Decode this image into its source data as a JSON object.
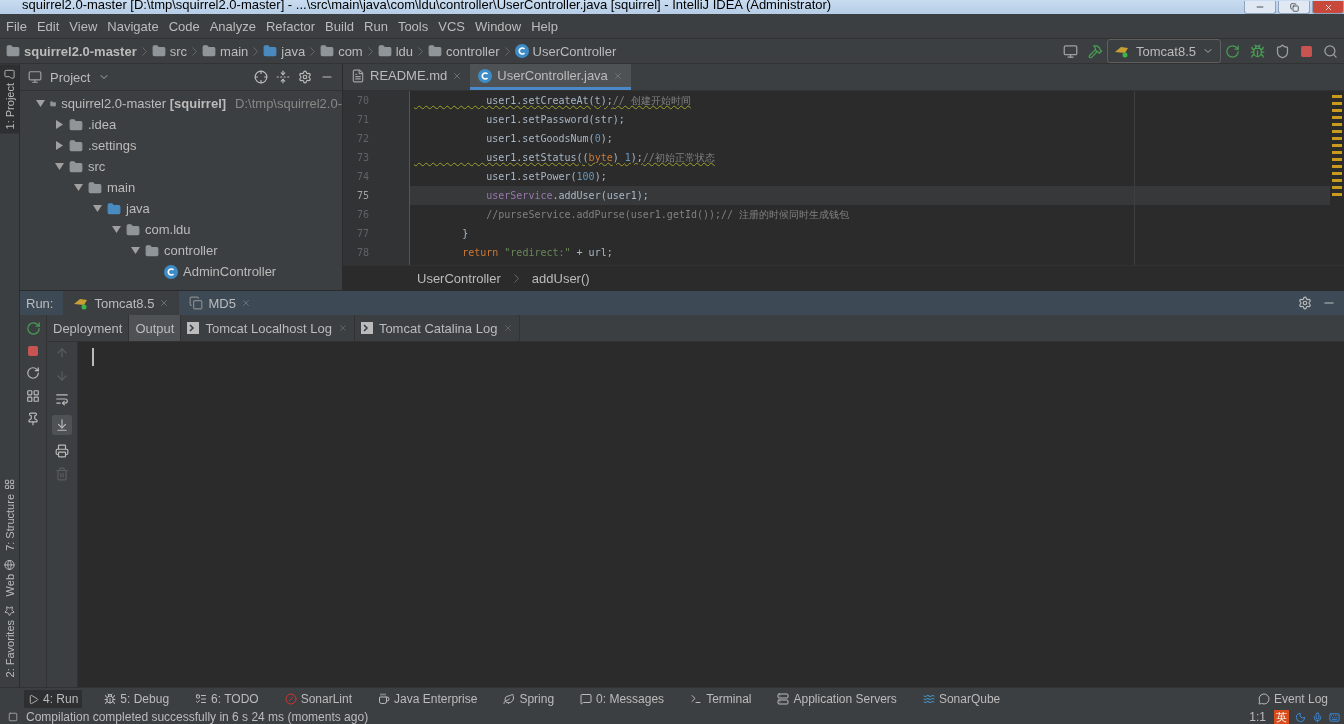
{
  "window": {
    "title": "squirrel2.0-master [D:\\tmp\\squirrel2.0-master] - ...\\src\\main\\java\\com\\ldu\\controller\\UserController.java [squirrel] - IntelliJ IDEA (Administrator)"
  },
  "menu": [
    "File",
    "Edit",
    "View",
    "Navigate",
    "Code",
    "Analyze",
    "Refactor",
    "Build",
    "Run",
    "Tools",
    "VCS",
    "Window",
    "Help"
  ],
  "breadcrumbs": [
    {
      "label": "squirrel2.0-master",
      "kind": "module"
    },
    {
      "label": "src",
      "kind": "folder"
    },
    {
      "label": "main",
      "kind": "folder"
    },
    {
      "label": "java",
      "kind": "source"
    },
    {
      "label": "com",
      "kind": "package"
    },
    {
      "label": "ldu",
      "kind": "package"
    },
    {
      "label": "controller",
      "kind": "package"
    },
    {
      "label": "UserController",
      "kind": "class"
    }
  ],
  "run_config": "Tomcat8.5",
  "side_tabs": [
    {
      "label": "1: Project",
      "selected": true
    },
    {
      "label": "7: Structure",
      "selected": false
    },
    {
      "label": "Web",
      "selected": false
    },
    {
      "label": "2: Favorites",
      "selected": false
    }
  ],
  "project": {
    "title": "Project",
    "tree": [
      {
        "label": "squirrel2.0-master **[squirrel]**",
        "path": "D:\\tmp\\squirrel2.0-",
        "kind": "module",
        "expanded": true,
        "children": [
          {
            "label": ".idea",
            "kind": "folder",
            "expanded": false
          },
          {
            "label": ".settings",
            "kind": "folder",
            "expanded": false
          },
          {
            "label": "src",
            "kind": "folder",
            "expanded": true,
            "children": [
              {
                "label": "main",
                "kind": "folder",
                "expanded": true,
                "children": [
                  {
                    "label": "java",
                    "kind": "source",
                    "expanded": true,
                    "children": [
                      {
                        "label": "com.ldu",
                        "kind": "package",
                        "expanded": true,
                        "children": [
                          {
                            "label": "controller",
                            "kind": "package",
                            "expanded": true,
                            "children": [
                              {
                                "label": "AdminController",
                                "kind": "class"
                              }
                            ]
                          }
                        ]
                      }
                    ]
                  }
                ]
              }
            ]
          }
        ]
      }
    ]
  },
  "editor": {
    "tabs": [
      {
        "label": "README.md",
        "kind": "markdown",
        "selected": false
      },
      {
        "label": "UserController.java",
        "kind": "class",
        "selected": true
      }
    ],
    "lines": [
      {
        "number": "70",
        "warning": true,
        "current": false,
        "tokens": [
          {
            "text": "            user1.setCreateAt(t);",
            "kind": "plain"
          },
          {
            "text": "// 创建开始时间",
            "kind": "comment"
          }
        ]
      },
      {
        "number": "71",
        "warning": false,
        "current": false,
        "tokens": [
          {
            "text": "            user1.setPassword(str);",
            "kind": "plain"
          }
        ]
      },
      {
        "number": "72",
        "warning": false,
        "current": false,
        "tokens": [
          {
            "text": "            user1.setGoodsNum(",
            "kind": "plain"
          },
          {
            "text": "0",
            "kind": "number"
          },
          {
            "text": ");",
            "kind": "plain"
          }
        ]
      },
      {
        "number": "73",
        "warning": true,
        "current": false,
        "tokens": [
          {
            "text": "            user1.setStatus((",
            "kind": "plain"
          },
          {
            "text": "byte",
            "kind": "keyword"
          },
          {
            "text": ") ",
            "kind": "plain"
          },
          {
            "text": "1",
            "kind": "number"
          },
          {
            "text": ");",
            "kind": "plain"
          },
          {
            "text": "//初始正常状态",
            "kind": "comment"
          }
        ]
      },
      {
        "number": "74",
        "warning": false,
        "current": false,
        "tokens": [
          {
            "text": "            user1.setPower(",
            "kind": "plain"
          },
          {
            "text": "100",
            "kind": "number"
          },
          {
            "text": ");",
            "kind": "plain"
          }
        ]
      },
      {
        "number": "75",
        "warning": false,
        "current": true,
        "tokens": [
          {
            "text": "            userService",
            "kind": "field"
          },
          {
            "text": ".addUser(user1);",
            "kind": "plain"
          }
        ]
      },
      {
        "number": "76",
        "warning": false,
        "current": false,
        "tokens": [
          {
            "text": "            //purseService.addPurse(user1.getId());// 注册的时候同时生成钱包",
            "kind": "comment"
          }
        ]
      },
      {
        "number": "77",
        "warning": false,
        "current": false,
        "tokens": [
          {
            "text": "        }",
            "kind": "plain"
          }
        ]
      },
      {
        "number": "78",
        "warning": false,
        "current": false,
        "tokens": [
          {
            "text": "        return",
            "kind": "keyword"
          },
          {
            "text": " \"redirect:\"",
            "kind": "string"
          },
          {
            "text": " + url;",
            "kind": "plain"
          }
        ]
      }
    ],
    "path": [
      "UserController",
      "addUser()"
    ]
  },
  "run": {
    "label": "Run:",
    "tabs": [
      {
        "label": "Tomcat8.5",
        "kind": "tomcat",
        "selected": true
      },
      {
        "label": "MD5",
        "kind": "app",
        "selected": false
      }
    ],
    "subtabs": [
      {
        "label": "Deployment",
        "kind": "plain",
        "selected": false
      },
      {
        "label": "Output",
        "kind": "plain",
        "selected": false,
        "active": true
      },
      {
        "label": "Tomcat Localhost Log",
        "kind": "log",
        "selected": false
      },
      {
        "label": "Tomcat Catalina Log",
        "kind": "log",
        "selected": false
      }
    ]
  },
  "tool_windows": [
    {
      "label": "4: Run",
      "selected": true
    },
    {
      "label": "5: Debug",
      "selected": false
    },
    {
      "label": "6: TODO",
      "selected": false
    },
    {
      "label": "SonarLint",
      "selected": false
    },
    {
      "label": "Java Enterprise",
      "selected": false
    },
    {
      "label": "Spring",
      "selected": false
    },
    {
      "label": "0: Messages",
      "selected": false
    },
    {
      "label": "Terminal",
      "selected": false
    },
    {
      "label": "Application Servers",
      "selected": false
    },
    {
      "label": "SonarQube",
      "selected": false
    }
  ],
  "event_log": "Event Log",
  "status": {
    "message": "Compilation completed successfully in 6 s 24 ms (moments ago)",
    "position": "1:1",
    "ime": "英"
  }
}
